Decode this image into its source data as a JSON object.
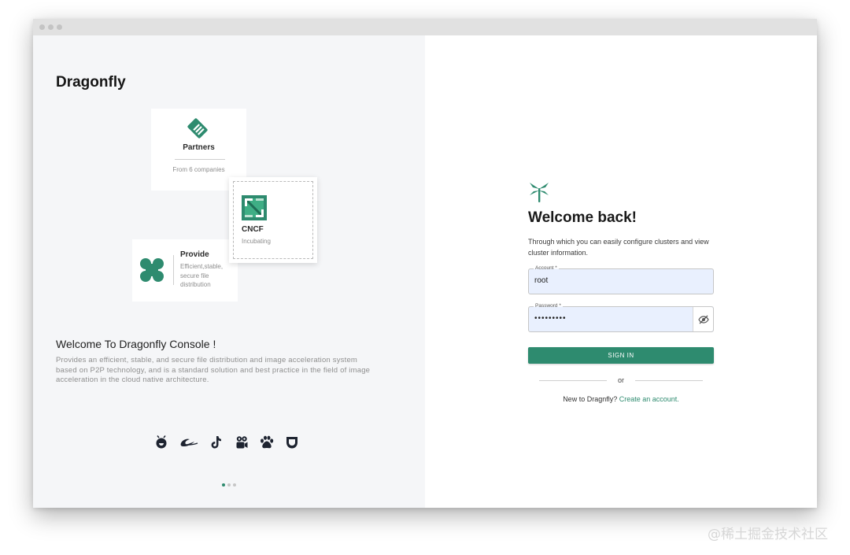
{
  "brand": {
    "name": "Dragonfly"
  },
  "cards": {
    "partners": {
      "title": "Partners",
      "subtitle": "From 6 companies"
    },
    "cncf": {
      "title": "CNCF",
      "subtitle": "Incubating"
    },
    "provide": {
      "title": "Provide",
      "subtitle": "Efficient,stable, secure file distribution"
    }
  },
  "intro": {
    "title": "Welcome To Dragonfly Console !",
    "description": "Provides an efficient, stable, and secure file distribution and image acceleration system based on P2P technology, and is a standard solution and best practice in the field of image acceleration in the cloud native architecture."
  },
  "partner_icons": [
    "ant-group-icon",
    "alibaba-icon",
    "tiktok-icon",
    "kuaishou-icon",
    "baidu-icon",
    "didi-icon"
  ],
  "carousel": {
    "active_index": 0,
    "count": 3
  },
  "login": {
    "title": "Welcome back!",
    "description": "Through which you can easily configure clusters and view cluster information.",
    "account_label": "Account *",
    "account_value": "root",
    "password_label": "Password *",
    "password_value": "•••••••••",
    "signin_label": "SIGN IN",
    "or_label": "or",
    "register_prompt": "New to Dragnfly?",
    "register_link": "Create an account."
  },
  "watermark": "@稀土掘金技术社区",
  "colors": {
    "accent": "#2e8b6f",
    "left_bg": "#f5f6f8",
    "input_bg": "#e9f0fe"
  }
}
